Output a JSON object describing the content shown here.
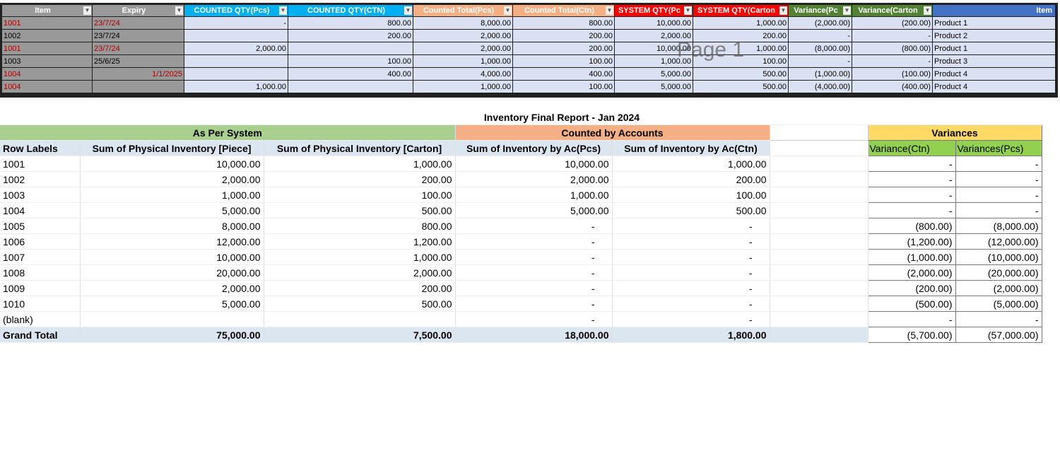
{
  "top_table": {
    "headers": [
      "Item",
      "Expiry",
      "COUNTED QTY(Pcs)",
      "COUNTED QTY(CTN)",
      "Counted Total(Pcs)",
      "Counted Total(Ctn)",
      "SYSTEM QTY(Pc",
      "SYSTEM QTY(Carton",
      "Variance(Pc",
      "Variance(Carton",
      "Item"
    ],
    "header_colors": [
      "#999999",
      "#999999",
      "#00b0f0",
      "#00b0f0",
      "#f4b084",
      "#f4b084",
      "#ff0000",
      "#ff0000",
      "#548235",
      "#548235",
      "#4472c4"
    ],
    "rows": [
      [
        "1001",
        "23/7/24",
        "-",
        "800.00",
        "8,000.00",
        "800.00",
        "10,000.00",
        "1,000.00",
        "(2,000.00)",
        "(200.00)",
        "Product 1"
      ],
      [
        "1002",
        "23/7/24",
        "",
        "200.00",
        "2,000.00",
        "200.00",
        "2,000.00",
        "200.00",
        "-",
        "-",
        "Product 2"
      ],
      [
        "1001",
        "23/7/24",
        "2,000.00",
        "",
        "2,000.00",
        "200.00",
        "10,000.00",
        "1,000.00",
        "(8,000.00)",
        "(800.00)",
        "Product 1"
      ],
      [
        "1003",
        "25/6/25",
        "",
        "100.00",
        "1,000.00",
        "100.00",
        "1,000.00",
        "100.00",
        "-",
        "-",
        "Product 3"
      ],
      [
        "1004",
        "1/1/2025",
        "",
        "400.00",
        "4,000.00",
        "400.00",
        "5,000.00",
        "500.00",
        "(1,000.00)",
        "(100.00)",
        "Product 4"
      ],
      [
        "1004",
        "",
        "1,000.00",
        "",
        "1,000.00",
        "100.00",
        "5,000.00",
        "500.00",
        "(4,000.00)",
        "(400.00)",
        "Product 4"
      ]
    ],
    "red_rows": [
      true,
      false,
      true,
      false,
      true,
      true
    ],
    "watermark": "Page 1"
  },
  "pivot": {
    "title": "Inventory Final Report - Jan 2024",
    "group_system": "As Per System",
    "group_counted": "Counted by Accounts",
    "group_variances": "Variances",
    "headers": [
      "Row Labels",
      "Sum of Physical Inventory [Piece]",
      "Sum of Physical Inventory [Carton]",
      "Sum of Inventory by Ac(Pcs)",
      "Sum of Inventory by Ac(Ctn)"
    ],
    "var_headers": [
      "Variance(Ctn)",
      "Variances(Pcs)"
    ],
    "rows": [
      [
        "1001",
        "10,000.00",
        "1,000.00",
        "10,000.00",
        "1,000.00",
        "-",
        "-"
      ],
      [
        "1002",
        "2,000.00",
        "200.00",
        "2,000.00",
        "200.00",
        "-",
        "-"
      ],
      [
        "1003",
        "1,000.00",
        "100.00",
        "1,000.00",
        "100.00",
        "-",
        "-"
      ],
      [
        "1004",
        "5,000.00",
        "500.00",
        "5,000.00",
        "500.00",
        "-",
        "-"
      ],
      [
        "1005",
        "8,000.00",
        "800.00",
        "-",
        "-",
        "(800.00)",
        "(8,000.00)"
      ],
      [
        "1006",
        "12,000.00",
        "1,200.00",
        "-",
        "-",
        "(1,200.00)",
        "(12,000.00)"
      ],
      [
        "1007",
        "10,000.00",
        "1,000.00",
        "-",
        "-",
        "(1,000.00)",
        "(10,000.00)"
      ],
      [
        "1008",
        "20,000.00",
        "2,000.00",
        "-",
        "-",
        "(2,000.00)",
        "(20,000.00)"
      ],
      [
        "1009",
        "2,000.00",
        "200.00",
        "-",
        "-",
        "(200.00)",
        "(2,000.00)"
      ],
      [
        "1010",
        "5,000.00",
        "500.00",
        "-",
        "-",
        "(500.00)",
        "(5,000.00)"
      ],
      [
        "(blank)",
        "",
        "",
        "-",
        "-",
        "-",
        "-"
      ]
    ],
    "grand_total": [
      "Grand Total",
      "75,000.00",
      "7,500.00",
      "18,000.00",
      "1,800.00",
      "(5,700.00)",
      "(57,000.00)"
    ]
  }
}
